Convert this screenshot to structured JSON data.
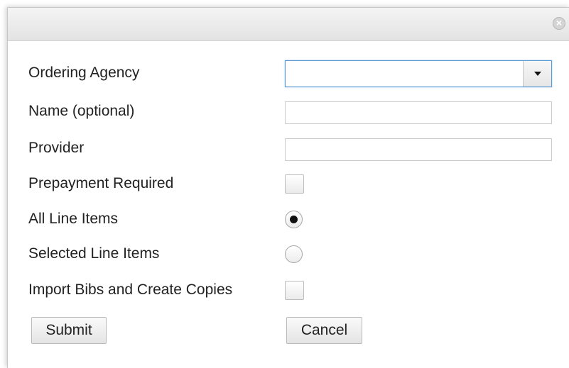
{
  "dialog": {
    "close_symbol": "×"
  },
  "form": {
    "ordering_agency_label": "Ordering Agency",
    "ordering_agency_value": "",
    "name_label": "Name (optional)",
    "name_value": "",
    "provider_label": "Provider",
    "provider_value": "",
    "prepayment_label": "Prepayment Required",
    "prepayment_checked": false,
    "all_line_items_label": "All Line Items",
    "all_line_items_selected": true,
    "selected_line_items_label": "Selected Line Items",
    "selected_line_items_selected": false,
    "import_bibs_label": "Import Bibs and Create Copies",
    "import_bibs_checked": false
  },
  "buttons": {
    "submit_label": "Submit",
    "cancel_label": "Cancel"
  }
}
